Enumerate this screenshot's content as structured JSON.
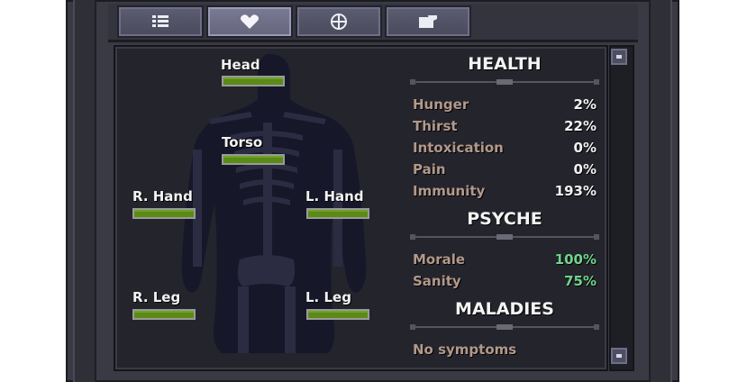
{
  "tabs": [
    {
      "name": "list-icon",
      "active": false
    },
    {
      "name": "heart-icon",
      "active": true
    },
    {
      "name": "crosshair-icon",
      "active": false
    },
    {
      "name": "note-icon",
      "active": false
    }
  ],
  "body_parts": {
    "head": {
      "label": "Head",
      "health": 1.0
    },
    "torso": {
      "label": "Torso",
      "health": 1.0
    },
    "r_hand": {
      "label": "R. Hand",
      "health": 1.0
    },
    "l_hand": {
      "label": "L. Hand",
      "health": 1.0
    },
    "r_leg": {
      "label": "R. Leg",
      "health": 1.0
    },
    "l_leg": {
      "label": "L. Leg",
      "health": 1.0
    }
  },
  "health": {
    "title": "HEALTH",
    "stats": [
      {
        "label": "Hunger",
        "value": "2%"
      },
      {
        "label": "Thirst",
        "value": "22%"
      },
      {
        "label": "Intoxication",
        "value": "0%"
      },
      {
        "label": "Pain",
        "value": "0%"
      },
      {
        "label": "Immunity",
        "value": "193%"
      }
    ]
  },
  "psyche": {
    "title": "PSYCHE",
    "stats": [
      {
        "label": "Morale",
        "value": "100%"
      },
      {
        "label": "Sanity",
        "value": "75%"
      }
    ]
  },
  "maladies": {
    "title": "MALADIES",
    "status": "No symptoms"
  },
  "colors": {
    "bar_fill": "#5b8a17",
    "good_value": "#6fd48a",
    "stat_label": "#b2998a"
  }
}
